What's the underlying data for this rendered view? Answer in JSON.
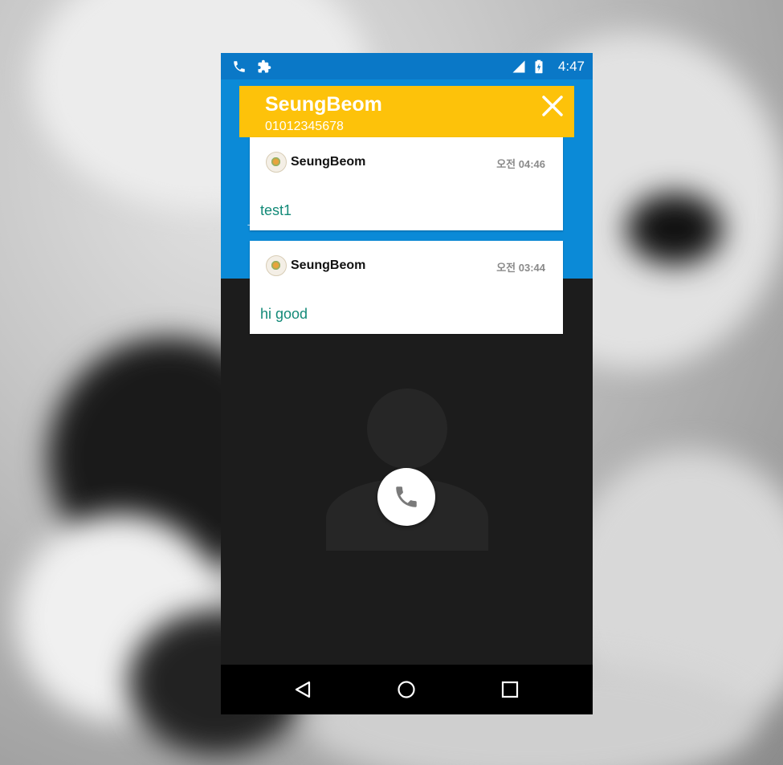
{
  "status_bar": {
    "time": "4:47",
    "icons": [
      "phone-icon",
      "puzzle-icon",
      "signal-icon",
      "battery-icon"
    ]
  },
  "caller_banner": {
    "name": "SeungBeom",
    "number": "01012345678",
    "close_icon": "close-icon",
    "background": "#fdc20a"
  },
  "messages": [
    {
      "sender": "SeungBeom",
      "time": "오전 04:46",
      "text": "test1"
    },
    {
      "sender": "SeungBeom",
      "time": "오전 03:44",
      "text": "hi good"
    }
  ],
  "call": {
    "answer_icon": "phone-icon"
  },
  "navigation": [
    "back-icon",
    "home-icon",
    "recents-icon"
  ],
  "colors": {
    "status_bar": "#0a78c7",
    "app_bar": "#0b8ad7",
    "message_text": "#138a78",
    "call_screen": "#1c1c1c"
  }
}
